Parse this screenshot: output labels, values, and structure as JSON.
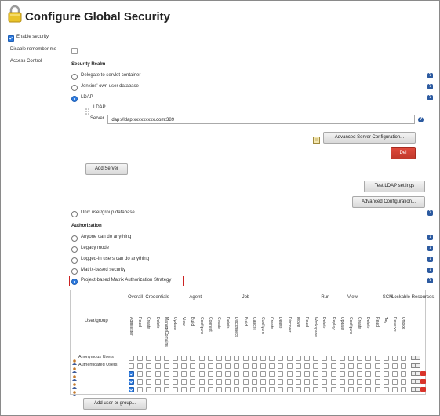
{
  "page": {
    "title": "Configure Global Security",
    "enable_security": "Enable security",
    "disable_remember_me": "Disable remember me",
    "access_control": "Access Control"
  },
  "security_realm": {
    "heading": "Security Realm",
    "options": [
      {
        "label": "Delegate to servlet container",
        "selected": false
      },
      {
        "label": "Jenkins' own user database",
        "selected": false
      },
      {
        "label": "LDAP",
        "selected": true
      }
    ],
    "ldap": {
      "section_label": "LDAP",
      "server_label": "Server",
      "server_value": "ldap://ldap.xxxxxxxxx.com:389",
      "advanced_server_config": "Advanced Server Configuration...",
      "delete": "Del",
      "add_server": "Add Server",
      "test_ldap": "Test LDAP settings",
      "advanced_config": "Advanced Configuration..."
    },
    "unix_option": "Unix user/group database"
  },
  "authorization": {
    "heading": "Authorization",
    "options": [
      {
        "label": "Anyone can do anything",
        "selected": false
      },
      {
        "label": "Legacy mode",
        "selected": false
      },
      {
        "label": "Logged-in users can do anything",
        "selected": false
      },
      {
        "label": "Matrix-based security",
        "selected": false
      },
      {
        "label": "Project-based Matrix Authorization Strategy",
        "selected": true
      }
    ]
  },
  "matrix": {
    "user_group_header": "User/group",
    "groups": [
      "Overall",
      "Credentials",
      "Agent",
      "Job",
      "Run",
      "View",
      "SCM",
      "Lockable Resources"
    ],
    "columns": [
      "Administer",
      "Read",
      "Create",
      "Delete",
      "ManageDomains",
      "Update",
      "View",
      "Build",
      "Configure",
      "Connect",
      "Create",
      "Delete",
      "Disconnect",
      "Build",
      "Cancel",
      "Configure",
      "Create",
      "Delete",
      "Discover",
      "Move",
      "Read",
      "Workspace",
      "Delete",
      "Replay",
      "Update",
      "Configure",
      "Create",
      "Delete",
      "Read",
      "Tag",
      "Reserve",
      "Unlock"
    ],
    "rows": [
      {
        "name": "Anonymous Users"
      },
      {
        "name": "Authenticated Users"
      },
      {
        "name": ""
      },
      {
        "name": ""
      },
      {
        "name": ""
      }
    ],
    "add_user_button": "Add user or group..."
  },
  "colors": {
    "accent": "#2d7be0",
    "help": "#2c5aa0",
    "delete_red": "#c0392b",
    "highlight_border": "#cc2222"
  }
}
